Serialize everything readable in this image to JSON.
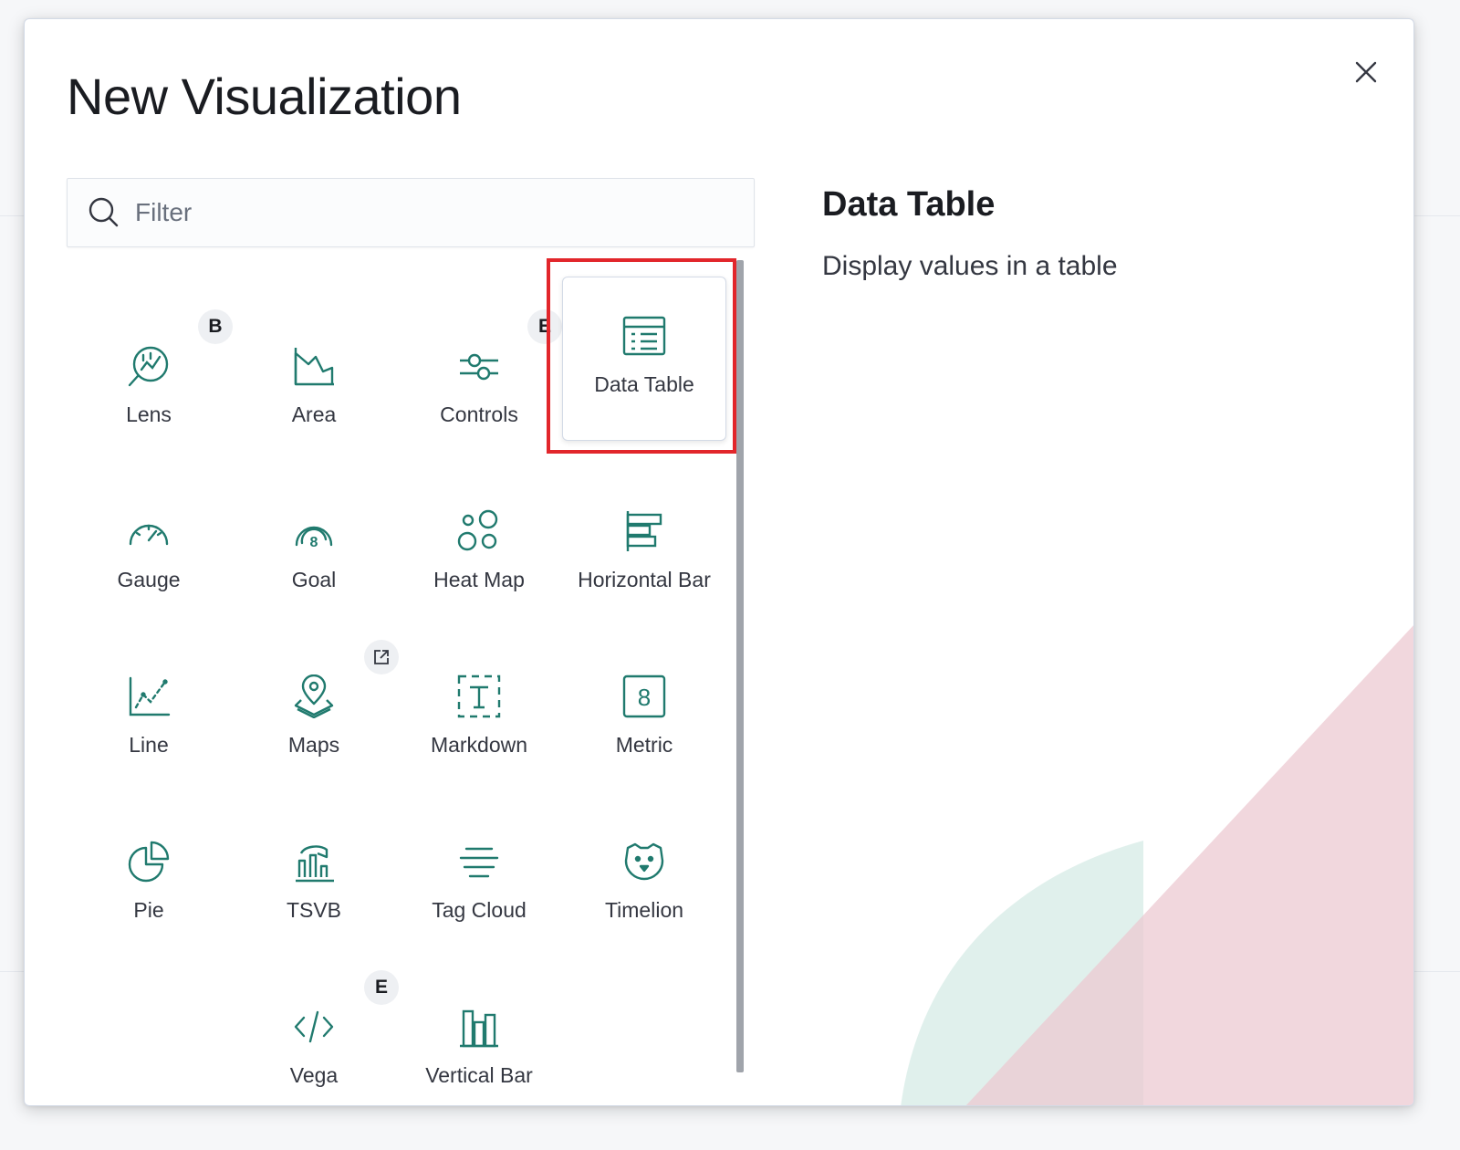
{
  "modal": {
    "title": "New Visualization",
    "close_icon": "close-icon"
  },
  "filter": {
    "placeholder": "Filter",
    "value": "",
    "icon": "search-icon"
  },
  "visualizations": [
    {
      "label": "Lens",
      "icon": "lens-icon",
      "badge": "B"
    },
    {
      "label": "Area",
      "icon": "area-chart-icon"
    },
    {
      "label": "Controls",
      "icon": "controls-icon",
      "badge": "E"
    },
    {
      "label": "Data Table",
      "icon": "data-table-icon",
      "selected": true
    },
    {
      "label": "Gauge",
      "icon": "gauge-icon"
    },
    {
      "label": "Goal",
      "icon": "goal-icon"
    },
    {
      "label": "Heat Map",
      "icon": "heat-map-icon"
    },
    {
      "label": "Horizontal Bar",
      "icon": "horizontal-bar-icon"
    },
    {
      "label": "Line",
      "icon": "line-chart-icon"
    },
    {
      "label": "Maps",
      "icon": "maps-icon",
      "badge_icon": "external-link-icon"
    },
    {
      "label": "Markdown",
      "icon": "markdown-icon"
    },
    {
      "label": "Metric",
      "icon": "metric-icon"
    },
    {
      "label": "Pie",
      "icon": "pie-chart-icon"
    },
    {
      "label": "TSVB",
      "icon": "tsvb-icon"
    },
    {
      "label": "Tag Cloud",
      "icon": "tag-cloud-icon"
    },
    {
      "label": "Timelion",
      "icon": "timelion-icon"
    },
    {
      "label": "Vega",
      "icon": "vega-code-icon",
      "badge": "E"
    },
    {
      "label": "Vertical Bar",
      "icon": "vertical-bar-icon"
    }
  ],
  "description": {
    "title": "Data Table",
    "text": "Display values in a table"
  },
  "colors": {
    "icon": "#207a6e",
    "highlight": "#e2262b",
    "decor_teal": "#d6ebe6",
    "decor_pink": "#ecc9d2"
  }
}
